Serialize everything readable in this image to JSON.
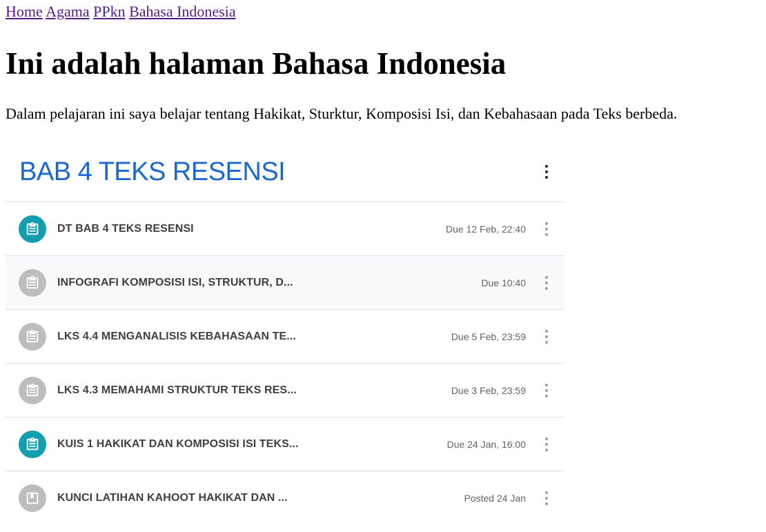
{
  "nav": {
    "links": [
      "Home",
      "Agama",
      "PPkn",
      "Bahasa Indonesia"
    ]
  },
  "heading": "Ini adalah halaman Bahasa Indonesia",
  "intro": "Dalam pelajaran ini saya belajar tentang Hakikat, Sturktur, Komposisi Isi, dan Kebahasaan pada Teks berbeda.",
  "classroom": {
    "topic_title": "BAB 4 TEKS RESENSI",
    "colors": {
      "accent": "#1967d2",
      "teal": "#129eaf",
      "grey": "#bdbdbd"
    },
    "items": [
      {
        "title": "DT BAB 4 TEKS RESENSI",
        "due": "Due 12 Feb, 22:40",
        "icon": "assignment-icon",
        "color": "teal"
      },
      {
        "title": "INFOGRAFI KOMPOSISI ISI, STRUKTUR, D...",
        "due": "Due 10:40",
        "icon": "assignment-icon",
        "color": "grey"
      },
      {
        "title": "LKS 4.4 MENGANALISIS KEBAHASAAN TE...",
        "due": "Due 5 Feb, 23:59",
        "icon": "assignment-icon",
        "color": "grey"
      },
      {
        "title": "LKS 4.3 MEMAHAMI STRUKTUR TEKS RES...",
        "due": "Due 3 Feb, 23:59",
        "icon": "assignment-icon",
        "color": "grey"
      },
      {
        "title": "KUIS 1 HAKIKAT DAN KOMPOSISI ISI TEKS...",
        "due": "Due 24 Jan, 16:00",
        "icon": "assignment-icon",
        "color": "teal"
      },
      {
        "title": "KUNCI LATIHAN KAHOOT HAKIKAT DAN ...",
        "due": "Posted 24 Jan",
        "icon": "material-icon",
        "color": "grey"
      }
    ]
  }
}
